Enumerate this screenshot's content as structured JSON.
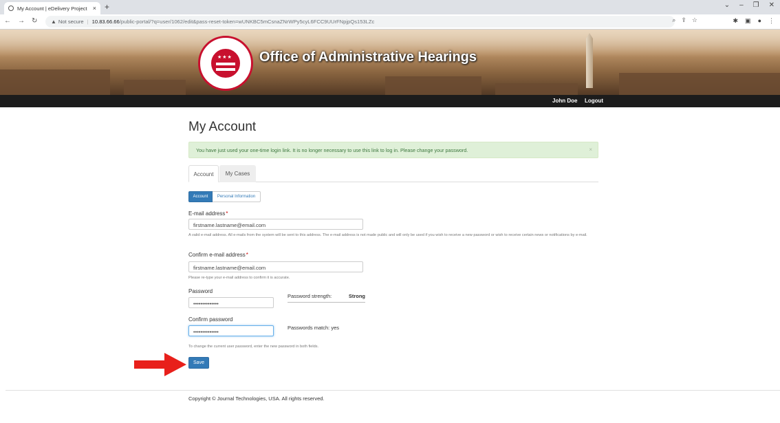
{
  "browser": {
    "tab_title": "My Account | eDelivery Project",
    "tab_close": "×",
    "new_tab": "+",
    "not_secure": "Not secure",
    "url_host": "10.83.66.66",
    "url_path": "/public-portal/?q=user/1062/edit&pass-reset-token=wUNKBC5mCsnaZNrWPy5cyL6FCC9UUrFNpjpQs153LZc"
  },
  "site": {
    "title": "Office of Administrative Hearings",
    "user_name": "John Doe",
    "logout_label": "Logout"
  },
  "page": {
    "heading": "My Account",
    "alert_text": "You have just used your one-time login link. It is no longer necessary to use this link to log in. Please change your password.",
    "alert_close": "×",
    "tabs": [
      "Account",
      "My Cases"
    ],
    "sub_tabs": [
      "Account",
      "Personal Information"
    ]
  },
  "form": {
    "email_label": "E-mail address",
    "email_value": "firstname.lastname@email.com",
    "email_help": "A valid e-mail address. All e-mails from the system will be sent to this address. The e-mail address is not made public and will only be used if you wish to receive a new password or wish to receive certain news or notifications by e-mail.",
    "confirm_email_label": "Confirm e-mail address",
    "confirm_email_value": "firstname.lastname@email.com",
    "confirm_email_help": "Please re-type your e-mail address to confirm it is accurate.",
    "password_label": "Password",
    "password_value": "••••••••••••••",
    "password_strength_label": "Password strength:",
    "password_strength_value": "Strong",
    "confirm_password_label": "Confirm password",
    "confirm_password_value": "••••••••••••••",
    "passwords_match": "Passwords match: yes",
    "password_help": "To change the current user password, enter the new password in both fields.",
    "required_marker": "*",
    "save_label": "Save"
  },
  "footer": {
    "copyright": "Copyright © Journal Technologies, USA. All rights reserved."
  },
  "colors": {
    "primary": "#337ab7",
    "alert_bg": "#dff0d8",
    "alert_text": "#3c763d",
    "navbar": "#1c1c1c",
    "arrow": "#e8201b"
  }
}
